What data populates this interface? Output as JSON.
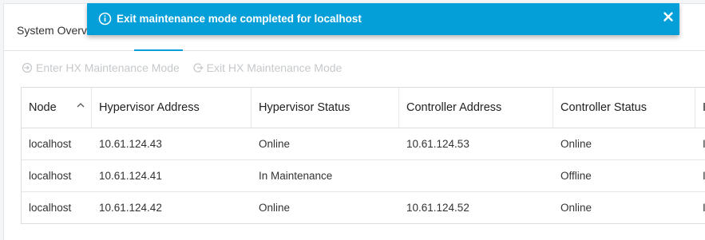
{
  "tabs": [
    {
      "label": "System Overview"
    },
    {
      "label": ""
    }
  ],
  "actions": {
    "enter_label": "Enter HX Maintenance Mode",
    "exit_label": "Exit HX Maintenance Mode"
  },
  "table": {
    "columns": [
      "Node",
      "Hypervisor Address",
      "Hypervisor Status",
      "Controller Address",
      "Controller Status",
      "I"
    ],
    "rows": [
      [
        "localhost",
        "10.61.124.43",
        "Online",
        "10.61.124.53",
        "Online",
        "I"
      ],
      [
        "localhost",
        "10.61.124.41",
        "In Maintenance",
        "",
        "Offline",
        "I"
      ],
      [
        "localhost",
        "10.61.124.42",
        "Online",
        "10.61.124.52",
        "Online",
        "I"
      ]
    ]
  },
  "toast": {
    "message": "Exit maintenance mode completed for localhost",
    "icon": "info-icon",
    "color": "#049fd9"
  }
}
